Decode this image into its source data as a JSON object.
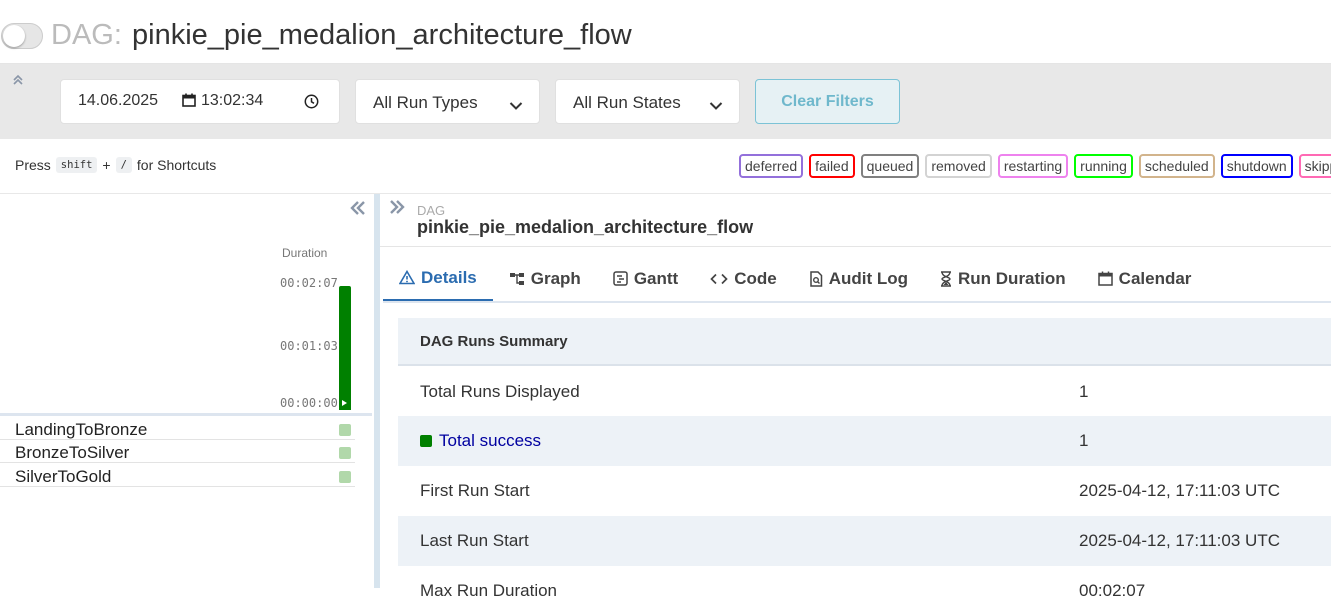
{
  "header": {
    "dag_prefix": "DAG:",
    "dag_id": "pinkie_pie_medalion_architecture_flow"
  },
  "filters": {
    "date": "14.06.2025",
    "time": "13:02:34",
    "run_types": "All Run Types",
    "run_states": "All Run States",
    "clear_label": "Clear Filters"
  },
  "shortcuts": {
    "press": "Press",
    "key1": "shift",
    "plus": "+",
    "key2": "/",
    "suffix": "for Shortcuts"
  },
  "states": [
    {
      "label": "deferred",
      "color": "#9370db"
    },
    {
      "label": "failed",
      "color": "#ff0000"
    },
    {
      "label": "queued",
      "color": "#808080"
    },
    {
      "label": "removed",
      "color": "#d3d3d3"
    },
    {
      "label": "restarting",
      "color": "#ee82ee"
    },
    {
      "label": "running",
      "color": "#00ff00"
    },
    {
      "label": "scheduled",
      "color": "#d2b48c"
    },
    {
      "label": "shutdown",
      "color": "#0000ff"
    },
    {
      "label": "skipped",
      "color": "#ff69b4"
    }
  ],
  "grid": {
    "duration_label": "Duration",
    "ticks": [
      "00:02:07",
      "00:01:03",
      "00:00:00"
    ],
    "tasks": [
      "LandingToBronze",
      "BronzeToSilver",
      "SilverToGold"
    ],
    "success_color": "#008000"
  },
  "details": {
    "small_label": "DAG",
    "dag_id": "pinkie_pie_medalion_architecture_flow",
    "tabs": [
      "Details",
      "Graph",
      "Gantt",
      "Code",
      "Audit Log",
      "Run Duration",
      "Calendar"
    ],
    "summary_title": "DAG Runs Summary",
    "rows": [
      {
        "key": "Total Runs Displayed",
        "value": "1"
      },
      {
        "key": "Total success",
        "value": "1"
      },
      {
        "key": "First Run Start",
        "value": "2025-04-12, 17:11:03 UTC"
      },
      {
        "key": "Last Run Start",
        "value": "2025-04-12, 17:11:03 UTC"
      },
      {
        "key": "Max Run Duration",
        "value": "00:02:07"
      }
    ]
  }
}
